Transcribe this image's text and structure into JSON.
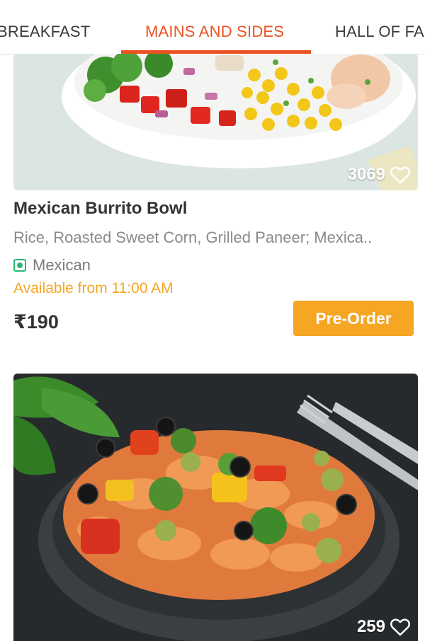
{
  "tabs": {
    "left": "BREAKFAST",
    "active": "MAINS AND SIDES",
    "right": "HALL OF FA"
  },
  "colors": {
    "accent": "#e95324",
    "cta": "#f5a623",
    "veg": "#2bb673"
  },
  "items": [
    {
      "likes": "3069",
      "title": "Mexican Burrito Bowl",
      "description": "Rice, Roasted Sweet Corn, Grilled Paneer; Mexica..",
      "cuisine": "Mexican",
      "availability": "Available from 11:00 AM",
      "price": "₹190",
      "cta": "Pre-Order",
      "veg_icon": "veg-indicator-icon",
      "like_icon": "heart-outline-icon"
    },
    {
      "likes": "259",
      "like_icon": "heart-outline-icon"
    }
  ]
}
